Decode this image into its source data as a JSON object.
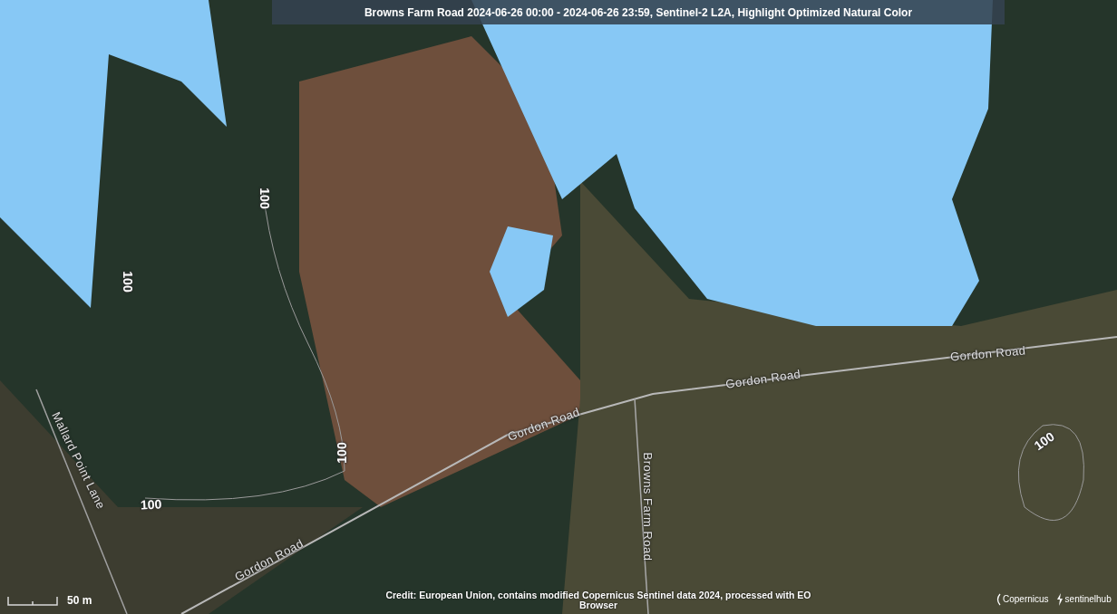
{
  "title_bar": {
    "text": "**Browns Farm Road** 2024-06-26 00:00 - 2024-06-26 23:59, Sentinel-2 L2A, Highlight Optimized Natural Color"
  },
  "map": {
    "labels": [
      {
        "kind": "road",
        "text": "Gordon Road"
      },
      {
        "kind": "road",
        "text": "Gordon Road"
      },
      {
        "kind": "road",
        "text": "Gordon Road"
      },
      {
        "kind": "road",
        "text": "Gordon Road"
      },
      {
        "kind": "road",
        "text": "Browns Farm Road"
      },
      {
        "kind": "road",
        "text": "Mallard Point Lane"
      },
      {
        "kind": "contour",
        "text": "100"
      },
      {
        "kind": "contour",
        "text": "100"
      },
      {
        "kind": "contour",
        "text": "100"
      },
      {
        "kind": "contour",
        "text": "100"
      },
      {
        "kind": "contour",
        "text": "100"
      }
    ]
  },
  "scale_bar": {
    "label": "50 m"
  },
  "credit": "Credit: European Union, contains modified Copernicus Sentinel data 2024, processed with EO Browser",
  "logos": [
    "Copernicus",
    "sentinelhub"
  ]
}
